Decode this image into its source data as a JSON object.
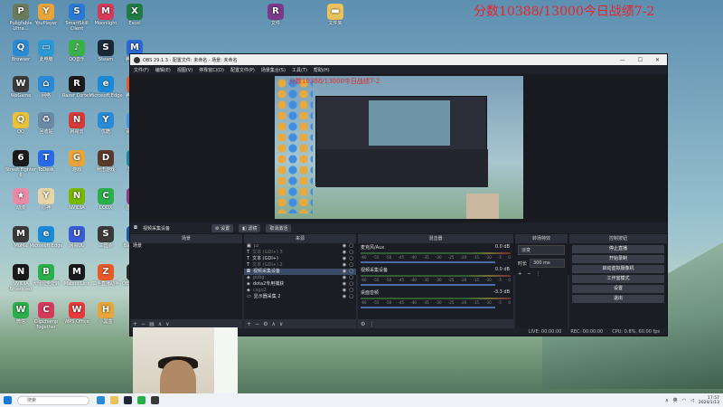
{
  "banner": "分数10388/13000今日战绩7-2",
  "desktop_icons": [
    {
      "label": "Pubgfable Ultra...",
      "icon": "pubg-icon",
      "color": "#6a7a5a",
      "glyph": "P"
    },
    {
      "label": "YouPlayer",
      "icon": "player-icon",
      "color": "#e8a63a",
      "glyph": "Y"
    },
    {
      "label": "SmartSkill Client",
      "icon": "app-icon",
      "color": "#2a78d6",
      "glyph": "S"
    },
    {
      "label": "Moonlight",
      "icon": "moonlight-icon",
      "color": "#d63a5a",
      "glyph": "M"
    },
    {
      "label": "Excel",
      "icon": "excel-icon",
      "color": "#1f7a45",
      "glyph": "X"
    },
    {
      "label": "Browser",
      "icon": "browser-icon",
      "color": "#2a8ad6",
      "glyph": "Q"
    },
    {
      "label": "文件",
      "icon": "winrar-icon",
      "color": "#7a3a8a",
      "glyph": "R"
    },
    {
      "label": "文件夹",
      "icon": "folder-icon",
      "color": "#e8c25a",
      "glyph": "▬"
    },
    {
      "label": "此电脑",
      "icon": "computer-icon",
      "color": "#2a9ad6",
      "glyph": "▭"
    },
    {
      "label": "QQ音乐",
      "icon": "music-icon",
      "color": "#3ab04a",
      "glyph": "♪"
    },
    {
      "label": "Steam",
      "icon": "steam-icon",
      "color": "#1b2838",
      "glyph": "S"
    },
    {
      "label": "腾讯会议",
      "icon": "app-icon",
      "color": "#2a6ad6",
      "glyph": "M"
    },
    {
      "label": "WeGame",
      "icon": "wegame-icon",
      "color": "#3a3a3a",
      "glyph": "W"
    },
    {
      "label": "网络",
      "icon": "network-icon",
      "color": "#2a8ad6",
      "glyph": "⌂"
    },
    {
      "label": "Razer Cortex",
      "icon": "razer-icon",
      "color": "#1a1a1a",
      "glyph": "R"
    },
    {
      "label": "Microsoft Edge",
      "icon": "edge-icon",
      "color": "#1a8ad6",
      "glyph": "e"
    },
    {
      "label": "腾讯视频",
      "icon": "video-icon",
      "color": "#e85a2a",
      "glyph": "▶"
    },
    {
      "label": "QQ",
      "icon": "qq-icon",
      "color": "#e8c23a",
      "glyph": "Q"
    },
    {
      "label": "回收站",
      "icon": "recycle-bin-icon",
      "color": "#6a8aa8",
      "glyph": "♻"
    },
    {
      "label": "网易云",
      "icon": "app-icon",
      "color": "#d63a3a",
      "glyph": "N"
    },
    {
      "label": "优酷",
      "icon": "app-icon",
      "color": "#2a8ad6",
      "glyph": "Y"
    },
    {
      "label": "百度网盘",
      "icon": "cloud-icon",
      "color": "#3a9ae8",
      "glyph": "☁"
    },
    {
      "label": "Street Fighter 6",
      "icon": "game-icon",
      "color": "#1a1a1a",
      "glyph": "6"
    },
    {
      "label": "ToDesk",
      "icon": "todesk-icon",
      "color": "#2a6ae8",
      "glyph": "T"
    },
    {
      "label": "游戏",
      "icon": "game-icon",
      "color": "#e8a63a",
      "glyph": "G"
    },
    {
      "label": "射击游戏",
      "icon": "game-icon",
      "color": "#5a3a2a",
      "glyph": "D"
    },
    {
      "label": "加速器",
      "icon": "app-icon",
      "color": "#1a8aa8",
      "glyph": "◎"
    },
    {
      "label": "动漫",
      "icon": "anime-icon",
      "color": "#e88aa8",
      "glyph": "★"
    },
    {
      "label": "原神",
      "icon": "game-icon",
      "color": "#e8d6a8",
      "glyph": "Y"
    },
    {
      "label": "NVIDIA",
      "icon": "nvidia-icon",
      "color": "#76b900",
      "glyph": "N"
    },
    {
      "label": "CODX",
      "icon": "app-icon",
      "color": "#2ab04a",
      "glyph": "C"
    },
    {
      "label": "游戏平台",
      "icon": "game-icon",
      "color": "#8a3a8a",
      "glyph": "G"
    },
    {
      "label": "MuMu",
      "icon": "app-icon",
      "color": "#3a3a3a",
      "glyph": "M"
    },
    {
      "label": "Microsoft Edge",
      "icon": "edge-icon",
      "color": "#1a8ad6",
      "glyph": "e"
    },
    {
      "label": "网易UU",
      "icon": "app-icon",
      "color": "#3a5ad6",
      "glyph": "U"
    },
    {
      "label": "三国杀",
      "icon": "game-icon",
      "color": "#3a3a3a",
      "glyph": "S"
    },
    {
      "label": "Battle.net",
      "icon": "app-icon",
      "color": "#1a5aa8",
      "glyph": "B"
    },
    {
      "label": "NVIDIA Broadcast",
      "icon": "nvidia-icon",
      "color": "#1a1a1a",
      "glyph": "N"
    },
    {
      "label": "大师兄全能转",
      "icon": "app-icon",
      "color": "#2ab04a",
      "glyph": "B"
    },
    {
      "label": "Maono Link",
      "icon": "maono-icon",
      "color": "#1a1a1a",
      "glyph": "M"
    },
    {
      "label": "二手直播助手",
      "icon": "app-icon",
      "color": "#e85a2a",
      "glyph": "Z"
    },
    {
      "label": "OBS Studio",
      "icon": "obs-icon",
      "color": "#2a2a2a",
      "glyph": "◉"
    },
    {
      "label": "微信",
      "icon": "wechat-icon",
      "color": "#2ab04a",
      "glyph": "W"
    },
    {
      "label": "Clipchamp Together",
      "icon": "app-icon",
      "color": "#d63a5a",
      "glyph": "C"
    },
    {
      "label": "WPS Office",
      "icon": "wps-icon",
      "color": "#e83a3a",
      "glyph": "W"
    },
    {
      "label": "小黑盒",
      "icon": "app-icon",
      "color": "#e8a63a",
      "glyph": "H"
    }
  ],
  "obs": {
    "title": "OBS 29.1.3 - 配置文件: 未命名 - 场景: 未命名",
    "menu": [
      "文件(F)",
      "编辑(E)",
      "视图(V)",
      "停靠窗口(D)",
      "配置文件(P)",
      "场景集合(S)",
      "工具(T)",
      "帮助(H)"
    ],
    "window_controls": [
      "—",
      "☐",
      "✕"
    ],
    "source_toolbar": {
      "selected": "视频采集设备",
      "properties": "设置",
      "filters": "滤镜",
      "deactivate": "取消激活"
    },
    "docks": {
      "scenes": {
        "title": "场景",
        "items": [
          "场景"
        ]
      },
      "sources": {
        "title": "来源",
        "items": [
          {
            "name": "pz",
            "icon": "image-icon",
            "selected": false,
            "dim": true
          },
          {
            "name": "文本 (GDI+) 3",
            "icon": "text-icon",
            "selected": false,
            "dim": true
          },
          {
            "name": "文本 (GDI+)",
            "icon": "text-icon",
            "selected": false,
            "dim": false
          },
          {
            "name": "文本 (GDI+) 2",
            "icon": "text-icon",
            "selected": false,
            "dim": true
          },
          {
            "name": "视频采集设备",
            "icon": "camera-icon",
            "selected": true,
            "dim": false
          },
          {
            "name": "pubg",
            "icon": "game-icon",
            "selected": false,
            "dim": true
          },
          {
            "name": "dota2专用捕获",
            "icon": "game-icon",
            "selected": false,
            "dim": false
          },
          {
            "name": "csgo2",
            "icon": "game-icon",
            "selected": false,
            "dim": true
          },
          {
            "name": "显示器采集 2",
            "icon": "monitor-icon",
            "selected": false,
            "dim": false
          }
        ]
      },
      "mixer": {
        "title": "混音器",
        "channels": [
          {
            "name": "麦克风/Aux",
            "db": "0.0 dB"
          },
          {
            "name": "视频采集设备",
            "db": "0.0 dB"
          },
          {
            "name": "桌面音频",
            "db": "-3.3 dB"
          }
        ],
        "scale": [
          "-60",
          "-55",
          "-50",
          "-45",
          "-40",
          "-35",
          "-30",
          "-25",
          "-20",
          "-15",
          "-10",
          "-5",
          "0"
        ]
      },
      "transitions": {
        "title": "转场特效",
        "type": "淡变",
        "duration_label": "时长",
        "duration": "300 ms"
      },
      "controls": {
        "title": "控制按钮",
        "buttons": [
          "停止直播",
          "开始录制",
          "启动虚拟摄像机",
          "工作室模式",
          "设置",
          "退出"
        ]
      }
    },
    "status": {
      "live": "LIVE: 00:00:00",
      "rec": "REC: 00:00:00",
      "cpu": "CPU: 0.8%, 60.00 fps"
    }
  },
  "taskbar": {
    "search_placeholder": "搜索",
    "ime": "英",
    "time": "17:57",
    "date": "2024/1/13"
  }
}
